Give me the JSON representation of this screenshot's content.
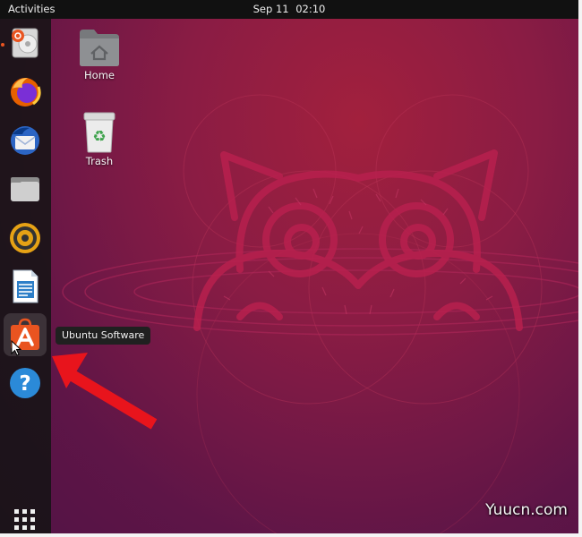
{
  "topbar": {
    "activities": "Activities",
    "date": "Sep 11",
    "time": "02:10"
  },
  "dock": {
    "items": [
      {
        "name": "Ubuntu Installer",
        "icon": "ubuntu-installer-icon"
      },
      {
        "name": "Firefox",
        "icon": "firefox-icon"
      },
      {
        "name": "Thunderbird",
        "icon": "thunderbird-icon"
      },
      {
        "name": "Files",
        "icon": "files-icon"
      },
      {
        "name": "Rhythmbox",
        "icon": "rhythmbox-icon"
      },
      {
        "name": "LibreOffice Writer",
        "icon": "writer-icon"
      },
      {
        "name": "Ubuntu Software",
        "icon": "ubuntu-software-icon"
      },
      {
        "name": "Help",
        "icon": "help-icon"
      }
    ],
    "show_apps_icon": "apps-grid-icon"
  },
  "tooltip": "Ubuntu Software",
  "desktop": {
    "icons": [
      {
        "label": "Home",
        "icon": "home-folder-icon"
      },
      {
        "label": "Trash",
        "icon": "trash-icon"
      }
    ]
  },
  "annotation": {
    "arrow_color": "#e8141c"
  },
  "colors": {
    "ubuntu_orange": "#e95420",
    "wallpaper": "#7d1a48"
  },
  "watermark": "Yuucn.com"
}
